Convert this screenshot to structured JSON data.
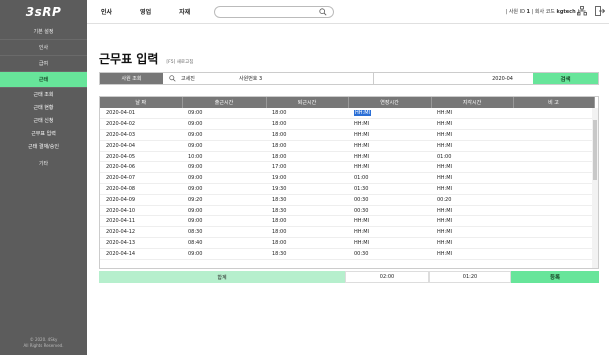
{
  "logo": "3sRP",
  "sidebar": {
    "menu": [
      "기본 설정",
      "인사",
      "급여",
      "근태"
    ],
    "active_index": 3,
    "sub": [
      "근태 조회",
      "근태 현황",
      "근태 신청",
      "근무표 입력",
      "근태 결재/승인"
    ],
    "other": "기타",
    "copyright": [
      "© 2020. 4Sky",
      "All Rights Reserved."
    ]
  },
  "topbar": {
    "nav": [
      "인사",
      "영업",
      "자재"
    ],
    "search_placeholder": "",
    "user_id_label": "사원 ID",
    "user_id": "1",
    "company_label": "회사 코드",
    "company": "kgtech"
  },
  "page": {
    "title": "근무표 입력",
    "refresh": "[F5] 새로고침"
  },
  "filter": {
    "label": "사원 조회",
    "employee": "고세진",
    "emp_no_label": "사원번호",
    "emp_no": "3",
    "month": "2020-04",
    "search_btn": "검색"
  },
  "grid": {
    "headers": [
      "날 짜",
      "출근시간",
      "퇴근시간",
      "연장시간",
      "지각시간",
      "비 고"
    ],
    "rows": [
      [
        "2020-04-01",
        "09:00",
        "18:00",
        "HH:MI",
        "HH:MI",
        ""
      ],
      [
        "2020-04-02",
        "09:00",
        "18:00",
        "HH:MI",
        "HH:MI",
        ""
      ],
      [
        "2020-04-03",
        "09:00",
        "18:00",
        "HH:MI",
        "HH:MI",
        ""
      ],
      [
        "2020-04-04",
        "09:00",
        "18:00",
        "HH:MI",
        "HH:MI",
        ""
      ],
      [
        "2020-04-05",
        "10:00",
        "18:00",
        "HH:MI",
        "01:00",
        ""
      ],
      [
        "2020-04-06",
        "09:00",
        "17:00",
        "HH:MI",
        "HH:MI",
        ""
      ],
      [
        "2020-04-07",
        "09:00",
        "19:00",
        "01:00",
        "HH:MI",
        ""
      ],
      [
        "2020-04-08",
        "09:00",
        "19:30",
        "01:30",
        "HH:MI",
        ""
      ],
      [
        "2020-04-09",
        "09:20",
        "18:30",
        "00:30",
        "00:20",
        ""
      ],
      [
        "2020-04-10",
        "09:00",
        "18:30",
        "00:30",
        "HH:MI",
        ""
      ],
      [
        "2020-04-11",
        "09:00",
        "18:00",
        "HH:MI",
        "HH:MI",
        ""
      ],
      [
        "2020-04-12",
        "08:30",
        "18:00",
        "HH:MI",
        "HH:MI",
        ""
      ],
      [
        "2020-04-13",
        "08:40",
        "18:00",
        "HH:MI",
        "HH:MI",
        ""
      ],
      [
        "2020-04-14",
        "09:00",
        "18:30",
        "00:30",
        "HH:MI",
        ""
      ]
    ]
  },
  "total": {
    "label": "합계",
    "overtime": "02:00",
    "late": "01:20",
    "register_btn": "등록"
  }
}
